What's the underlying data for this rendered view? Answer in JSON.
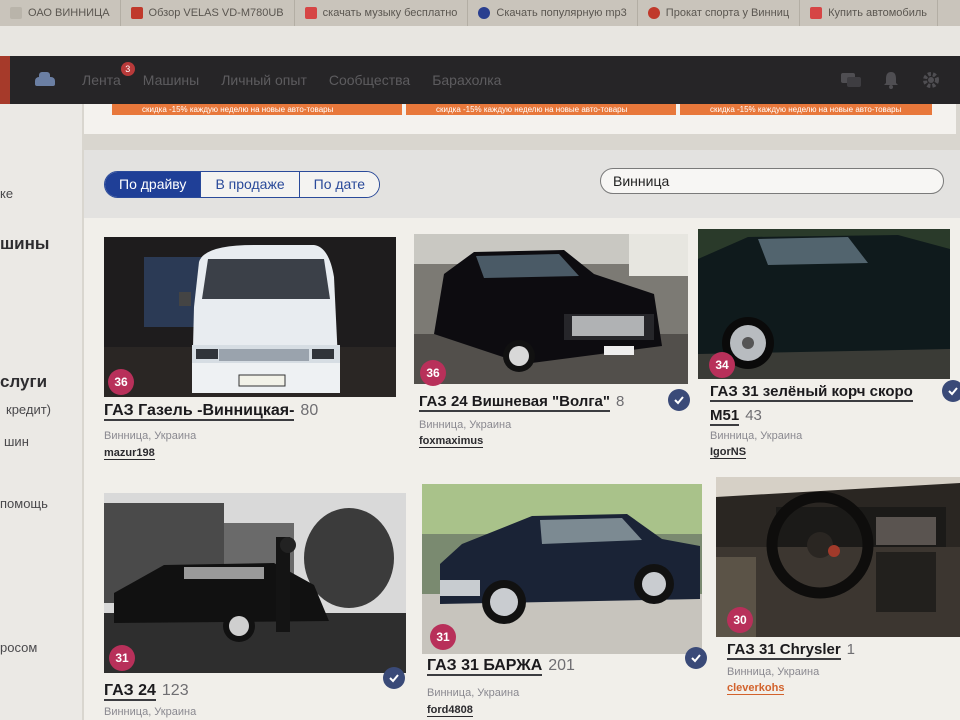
{
  "browser": {
    "bookmarks": [
      {
        "label": "ОАО ВИННИЦА",
        "color": "#b9b4aa"
      },
      {
        "label": "Обзор VELAS VD-M780UB",
        "color": "#c0392b"
      },
      {
        "label": "скачать музыку бесплатно",
        "color": "#d64545"
      },
      {
        "label": "Скачать популярную mp3",
        "color": "#2a3f8f"
      },
      {
        "label": "Прокат спорта у Винниц",
        "color": "#c0392b"
      },
      {
        "label": "Купить автомобиль",
        "color": "#d64545"
      }
    ]
  },
  "nav": {
    "items": [
      "Лента",
      "Машины",
      "Личный опыт",
      "Сообщества",
      "Барахолка"
    ],
    "feed_badge": "3",
    "icons": [
      "chat-icon",
      "bell-icon",
      "gear-icon"
    ]
  },
  "sidebar": {
    "items": [
      "ке",
      "шины",
      "слуги",
      "кредит)",
      "шин",
      "помощь",
      "росом"
    ]
  },
  "promo": {
    "text": "скидка -15% каждую неделю на новые авто-товары"
  },
  "filters": {
    "tabs": [
      "По драйву",
      "В продаже",
      "По дате"
    ],
    "active": "По драйву",
    "search_value": "Винница"
  },
  "cards": [
    {
      "title": "ГАЗ Газель -Винницкая-",
      "count": "80",
      "badge": "36",
      "location": "Винница, Украина",
      "user": "mazur198",
      "verified": false
    },
    {
      "title": "ГАЗ 24 Вишневая \"Волга\"",
      "count": "8",
      "badge": "36",
      "location": "Винница, Украина",
      "user": "foxmaximus",
      "verified": true
    },
    {
      "title": "ГАЗ 31 зелёный корч скоро",
      "title2": "М51",
      "count": "43",
      "badge": "34",
      "location": "Винница, Украина",
      "user": "IgorNS",
      "verified": true
    },
    {
      "title": "ГАЗ 24",
      "count": "123",
      "badge": "31",
      "location": "Винница, Украина",
      "user": "",
      "verified": true
    },
    {
      "title": "ГАЗ 31 БАРЖА",
      "count": "201",
      "badge": "31",
      "location": "Винница, Украина",
      "user": "ford4808",
      "verified": true
    },
    {
      "title": "ГАЗ 31 Chrysler",
      "count": "1",
      "badge": "30",
      "location": "Винница, Украина",
      "user": "cleverkohs",
      "verified": false
    }
  ]
}
